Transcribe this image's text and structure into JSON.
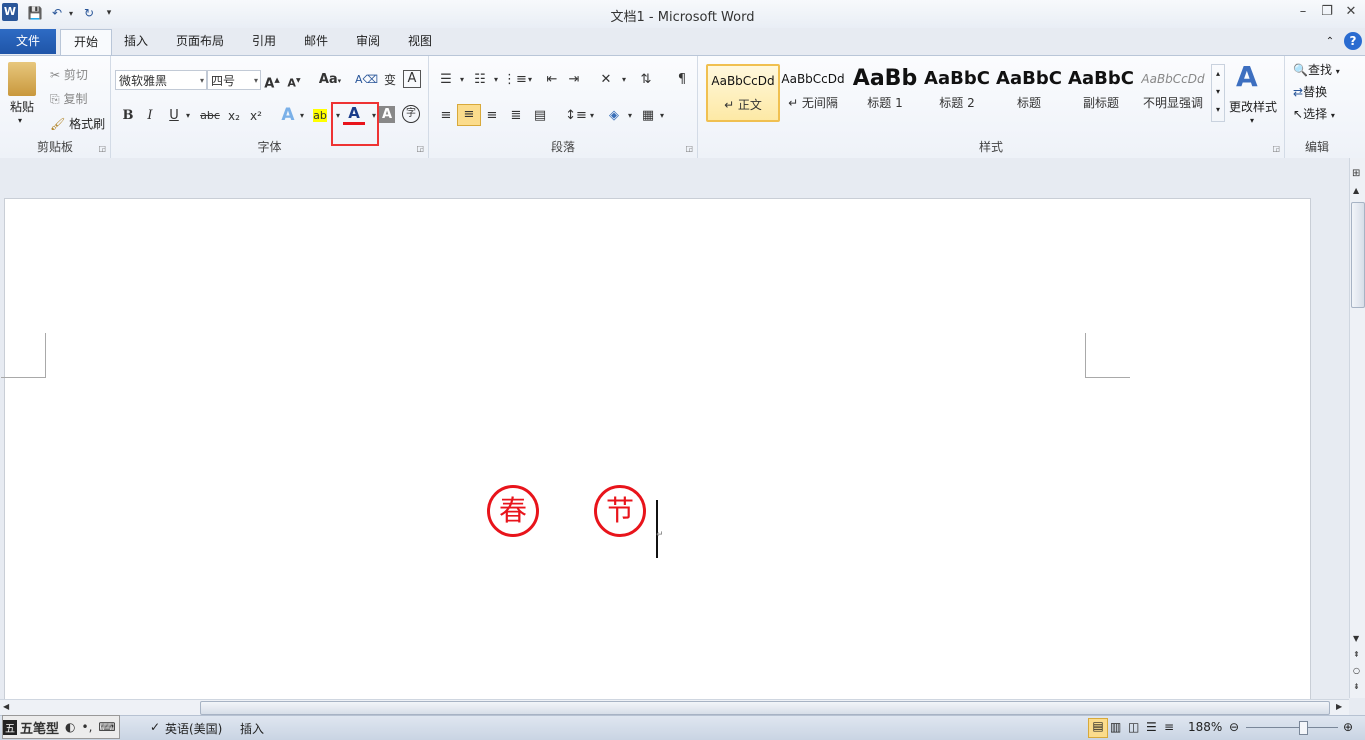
{
  "window": {
    "title": "文档1 - Microsoft Word",
    "minimize": "–",
    "restore": "❐",
    "close": "✕"
  },
  "quick_access": {
    "save_icon": "save-icon",
    "undo_icon": "undo-icon",
    "redo_icon": "redo-icon"
  },
  "tabs": [
    "文件",
    "开始",
    "插入",
    "页面布局",
    "引用",
    "邮件",
    "审阅",
    "视图"
  ],
  "clipboard": {
    "paste": "粘贴",
    "cut": "剪切",
    "copy": "复制",
    "format_painter": "格式刷",
    "group": "剪贴板"
  },
  "font": {
    "name": "微软雅黑",
    "size": "四号",
    "group": "字体",
    "bold": "B",
    "italic": "I",
    "underline": "U",
    "strike": "abc",
    "sub": "x₂",
    "sup": "x²",
    "grow": "A",
    "shrink": "A",
    "change_case": "Aa",
    "font_color_letter": "A",
    "char_shade": "A",
    "enclose": "字",
    "font_color": "#e8141b"
  },
  "paragraph": {
    "group": "段落"
  },
  "styles": {
    "group": "样式",
    "items": [
      {
        "preview": "AaBbCcDd",
        "name": "↵ 正文"
      },
      {
        "preview": "AaBbCcDd",
        "name": "↵ 无间隔"
      },
      {
        "preview": "AaBb",
        "name": "标题 1"
      },
      {
        "preview": "AaBbC",
        "name": "标题 2"
      },
      {
        "preview": "AaBbC",
        "name": "标题"
      },
      {
        "preview": "AaBbC",
        "name": "副标题"
      },
      {
        "preview": "AaBbCcDd",
        "name": "不明显强调"
      }
    ],
    "change_styles": "更改样式"
  },
  "editing": {
    "find": "查找",
    "replace": "替换",
    "select": "选择",
    "group": "编辑"
  },
  "document": {
    "char1": "春",
    "char2": "节",
    "paragraph_mark": "↵"
  },
  "status": {
    "ime": "五笔型",
    "language": "英语(美国)",
    "mode": "插入",
    "zoom": "188%"
  }
}
